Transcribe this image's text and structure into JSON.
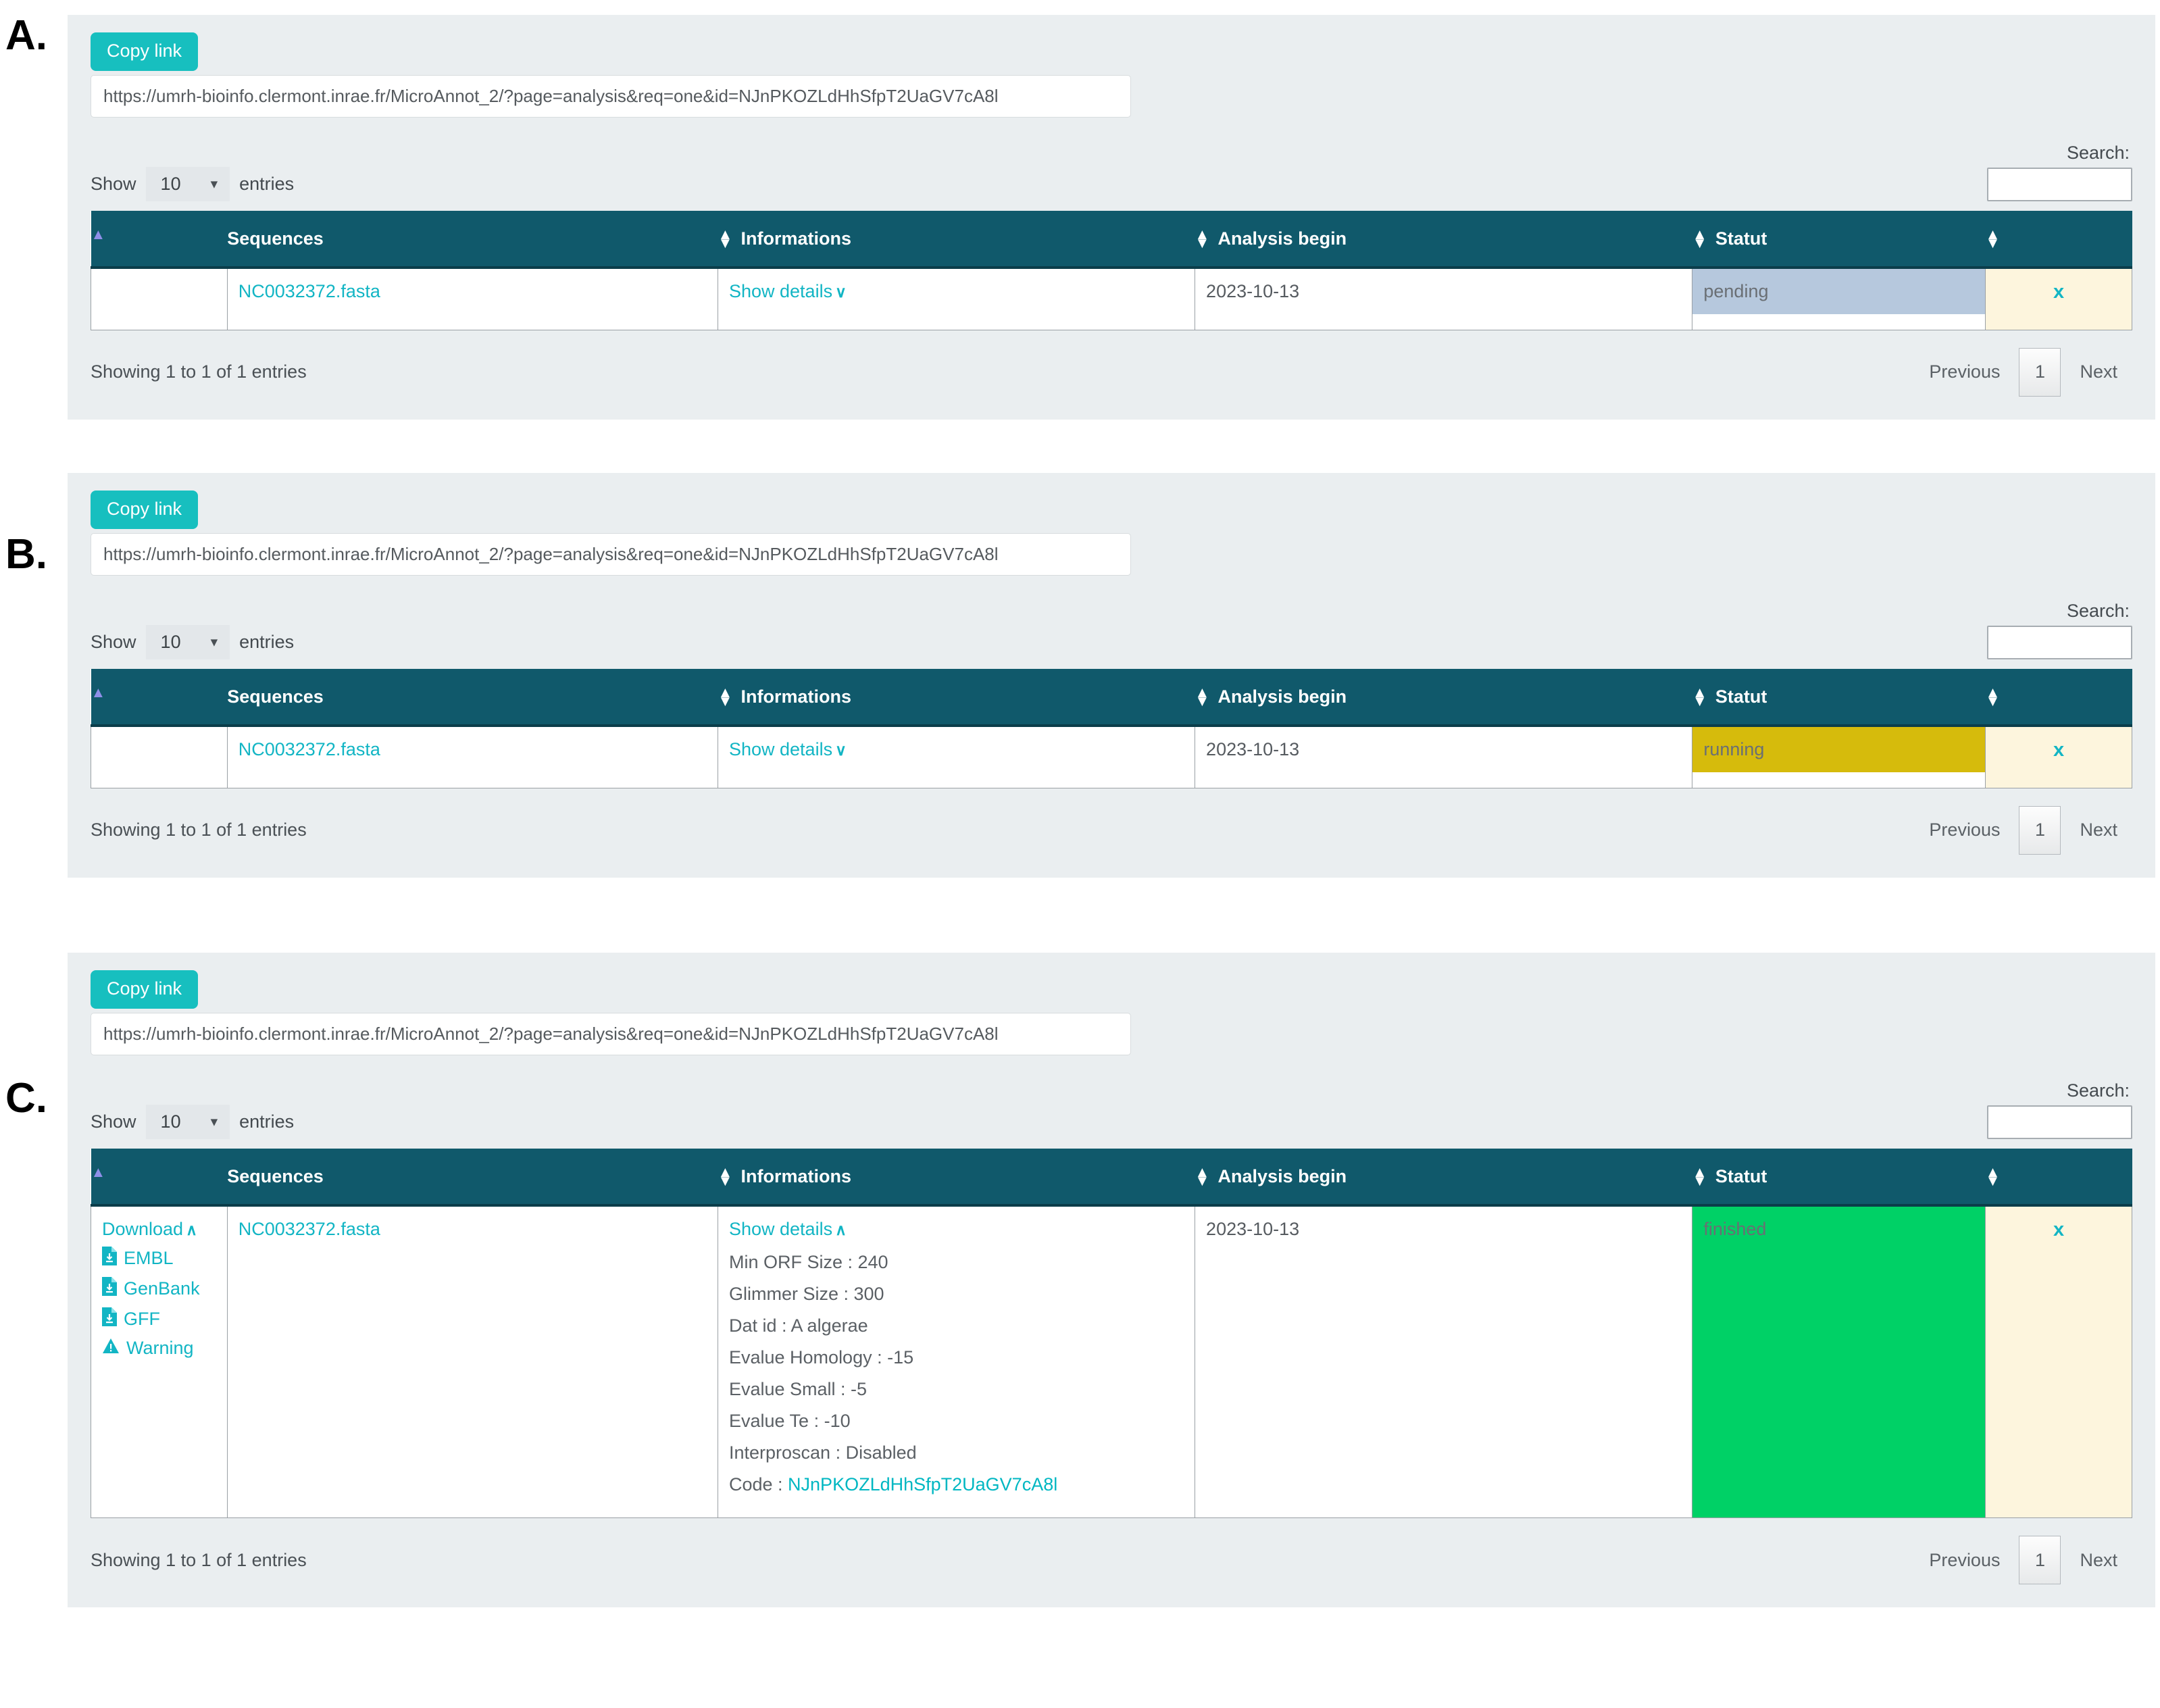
{
  "sections": [
    {
      "letter": "A.",
      "copy_link_label": "Copy link",
      "url": "https://umrh-bioinfo.clermont.inrae.fr/MicroAnnot_2/?page=analysis&req=one&id=NJnPKOZLdHhSfpT2UaGV7cA8l",
      "show_label": "Show",
      "entries_label": "entries",
      "page_length": "10",
      "search_label": "Search:",
      "search_value": "",
      "headers": [
        "",
        "Sequences",
        "Informations",
        "Analysis begin",
        "Statut",
        ""
      ],
      "row": {
        "download": null,
        "sequence": "NC0032372.fasta",
        "details_toggle": "Show details",
        "details_expanded": false,
        "analysis_begin": "2023-10-13",
        "status": "pending",
        "status_color": "#b6c8dd",
        "cancel": "x"
      },
      "info_text": "Showing 1 to 1 of 1 entries",
      "previous_label": "Previous",
      "page_number": "1",
      "next_label": "Next"
    },
    {
      "letter": "B.",
      "copy_link_label": "Copy link",
      "url": "https://umrh-bioinfo.clermont.inrae.fr/MicroAnnot_2/?page=analysis&req=one&id=NJnPKOZLdHhSfpT2UaGV7cA8l",
      "show_label": "Show",
      "entries_label": "entries",
      "page_length": "10",
      "search_label": "Search:",
      "search_value": "",
      "headers": [
        "",
        "Sequences",
        "Informations",
        "Analysis begin",
        "Statut",
        ""
      ],
      "row": {
        "download": null,
        "sequence": "NC0032372.fasta",
        "details_toggle": "Show details",
        "details_expanded": false,
        "analysis_begin": "2023-10-13",
        "status": "running",
        "status_color": "#d6bb0c",
        "cancel": "x"
      },
      "info_text": "Showing 1 to 1 of 1 entries",
      "previous_label": "Previous",
      "page_number": "1",
      "next_label": "Next"
    },
    {
      "letter": "C.",
      "copy_link_label": "Copy link",
      "url": "https://umrh-bioinfo.clermont.inrae.fr/MicroAnnot_2/?page=analysis&req=one&id=NJnPKOZLdHhSfpT2UaGV7cA8l",
      "show_label": "Show",
      "entries_label": "entries",
      "page_length": "10",
      "search_label": "Search:",
      "search_value": "",
      "headers": [
        "",
        "Sequences",
        "Informations",
        "Analysis begin",
        "Statut",
        ""
      ],
      "row": {
        "download": {
          "header": "Download",
          "items": [
            "EMBL",
            "GenBank",
            "GFF",
            "Warning"
          ]
        },
        "sequence": "NC0032372.fasta",
        "details_toggle": "Show details",
        "details_expanded": true,
        "details": [
          "Min ORF Size : 240",
          "Glimmer Size : 300",
          "Dat id : A algerae",
          "Evalue Homology : -15",
          "Evalue Small : -5",
          "Evalue Te : -10",
          "Interproscan : Disabled"
        ],
        "code_label": "Code : ",
        "code_value": "NJnPKOZLdHhSfpT2UaGV7cA8l",
        "analysis_begin": "2023-10-13",
        "status": "finished",
        "status_color": "#00d166",
        "cancel": "x"
      },
      "info_text": "Showing 1 to 1 of 1 entries",
      "previous_label": "Previous",
      "page_number": "1",
      "next_label": "Next"
    }
  ],
  "colors": {
    "accent_teal": "#17bfbf",
    "link_teal": "#12b5c4",
    "header_teal": "#10596b",
    "panel_bg": "#eaeef0",
    "cancel_bg": "#fdf5dd",
    "sort_active": "#8e8fe8"
  }
}
